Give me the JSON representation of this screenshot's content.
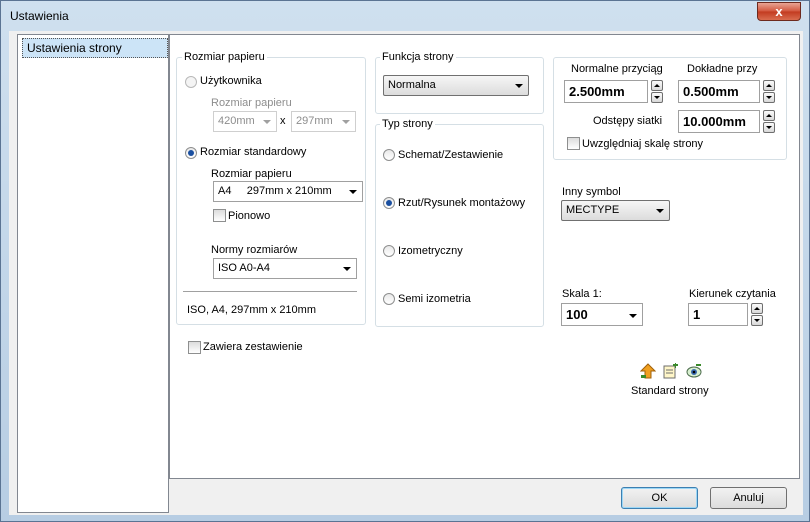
{
  "window": {
    "title": "Ustawienia",
    "close_glyph": "x"
  },
  "sidebar": {
    "items": [
      {
        "label": "Ustawienia strony",
        "selected": true
      }
    ]
  },
  "paper": {
    "legend": "Rozmiar papieru",
    "user_radio_label": "Użytkownika",
    "user_size_label": "Rozmiar papieru",
    "user_width": "420mm",
    "user_x": "x",
    "user_height": "297mm",
    "standard_radio_label": "Rozmiar standardowy",
    "standard_size_label": "Rozmiar papieru",
    "standard_size_value": "A4     297mm x 210mm",
    "portrait_label": "Pionowo",
    "norms_label": "Normy rozmiarów",
    "norms_value": "ISO A0-A4",
    "summary": "ISO, A4, 297mm x 210mm"
  },
  "contains_list_label": "Zawiera zestawienie",
  "page_function": {
    "legend": "Funkcja strony",
    "value": "Normalna"
  },
  "page_type": {
    "legend": "Typ strony",
    "options": [
      {
        "label": "Schemat/Zestawienie",
        "selected": false
      },
      {
        "label": "Rzut/Rysunek montażowy",
        "selected": true
      },
      {
        "label": "Izometryczny",
        "selected": false
      },
      {
        "label": "Semi izometria",
        "selected": false
      }
    ]
  },
  "snap": {
    "normal_label": "Normalne przyciąg",
    "normal_value": "2.500mm",
    "fine_label": "Dokładne przy",
    "fine_value": "0.500mm",
    "grid_label": "Odstępy siatki",
    "grid_value": "10.000mm",
    "scale_check_label": "Uwzględniaj skalę strony"
  },
  "other_symbol": {
    "label": "Inny symbol",
    "value": "MECTYPE"
  },
  "scale": {
    "label": "Skala 1:",
    "value": "100"
  },
  "reading_direction": {
    "label": "Kierunek czytania",
    "value": "1"
  },
  "page_standard": {
    "label": "Standard strony",
    "icons": [
      "arrow-up-icon",
      "edit-page-icon",
      "view-eye-icon"
    ]
  },
  "buttons": {
    "ok": "OK",
    "cancel": "Anuluj"
  }
}
